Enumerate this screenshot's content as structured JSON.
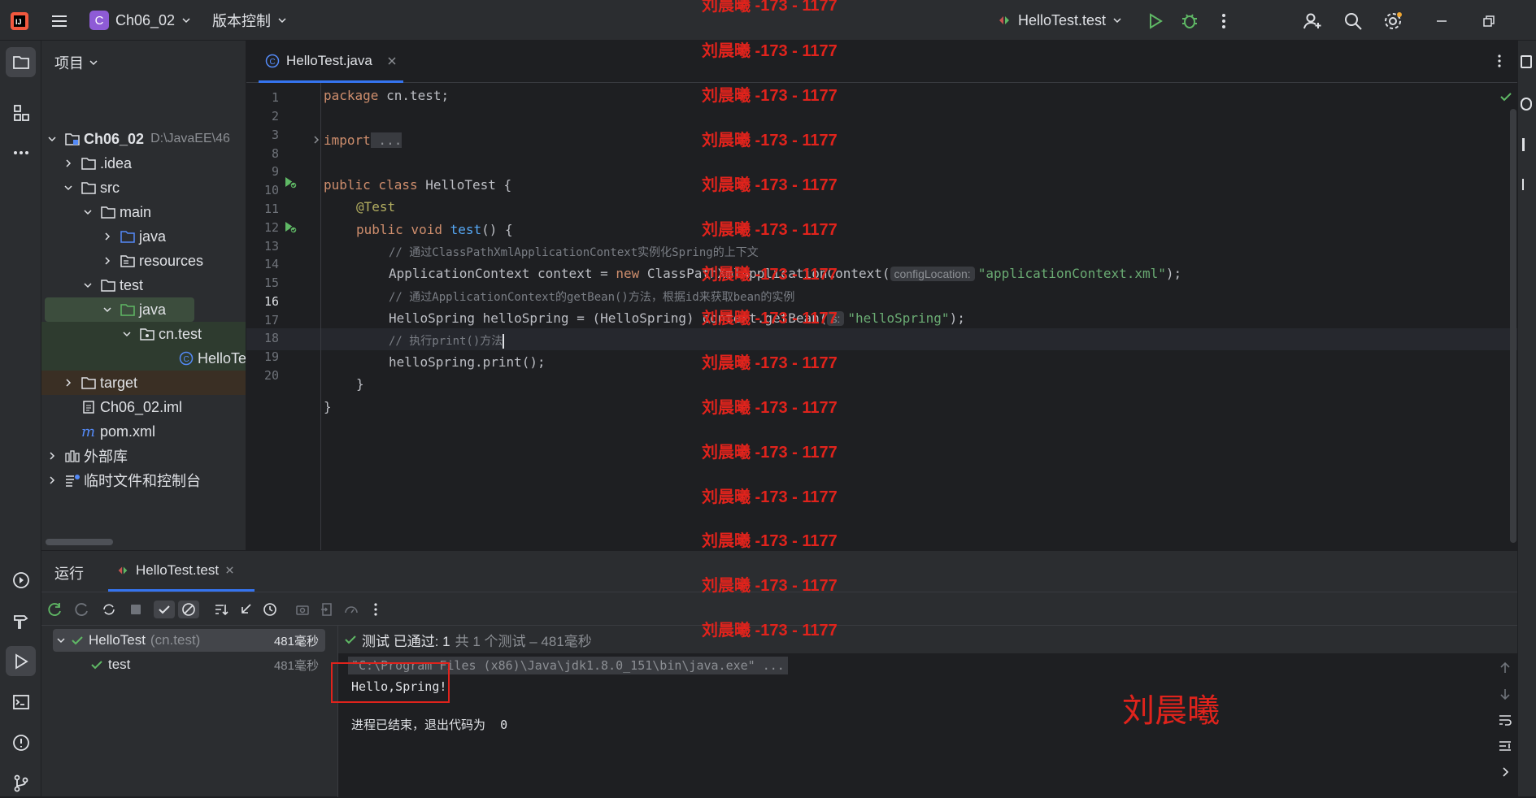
{
  "titlebar": {
    "project_initial": "C",
    "project_name": "Ch06_02",
    "vcs_menu": "版本控制",
    "run_config": "HelloTest.test"
  },
  "project_panel": {
    "title": "项目",
    "tree": [
      {
        "label": "Ch06_02",
        "hint": "D:\\JavaEE\\46",
        "bold": true
      },
      {
        "label": ".idea"
      },
      {
        "label": "src"
      },
      {
        "label": "main"
      },
      {
        "label": "java"
      },
      {
        "label": "resources"
      },
      {
        "label": "test"
      },
      {
        "label": "java"
      },
      {
        "label": "cn.test"
      },
      {
        "label": "HelloTest"
      },
      {
        "label": "target"
      },
      {
        "label": "Ch06_02.iml"
      },
      {
        "label": "pom.xml"
      },
      {
        "label": "外部库"
      },
      {
        "label": "临时文件和控制台"
      }
    ]
  },
  "editor": {
    "tab": "HelloTest.java",
    "line_numbers": [
      "1",
      "2",
      "3",
      "8",
      "9",
      "10",
      "11",
      "12",
      "13",
      "14",
      "15",
      "16",
      "17",
      "18",
      "19",
      "20"
    ],
    "lines": {
      "l1": [
        "package",
        " cn.test;"
      ],
      "l3": [
        "import",
        " ..."
      ],
      "l9": [
        "public class",
        " HelloTest {"
      ],
      "l10": "@Test",
      "l11": [
        "public void",
        " ",
        "test",
        "() {"
      ],
      "l12": "// 通过ClassPathXmlApplicationContext实例化Spring的上下文",
      "l13": [
        "ApplicationContext context = ",
        "new",
        " ClassPathXmlApplicationContext(",
        "configLocation:",
        "\"applicationContext.xml\"",
        ");"
      ],
      "l14": "// 通过ApplicationContext的getBean()方法，根据id来获取bean的实例",
      "l15": [
        "HelloSpring helloSpring = (HelloSpring) context.getBean(",
        "s:",
        "\"helloSpring\"",
        ");"
      ],
      "l16": "// 执行print()方法",
      "l17": "helloSpring.print();",
      "l18": "}",
      "l19": "}"
    }
  },
  "run_panel": {
    "tab_run": "运行",
    "tab_config": "HelloTest.test",
    "tree": [
      {
        "label": "HelloTest",
        "pkg": "(cn.test)",
        "time": "481毫秒"
      },
      {
        "label": "test",
        "time": "481毫秒"
      }
    ],
    "status_passed": "测试 已通过: 1",
    "status_rest": "共 1 个测试 – 481毫秒",
    "console": {
      "cmd": "\"C:\\Program Files (x86)\\Java\\jdk1.8.0_151\\bin\\java.exe\" ...",
      "out": "Hello,Spring!",
      "exit": "进程已结束，退出代码为  0"
    }
  },
  "watermark": {
    "text": "刘晨曦 -173 - 1177",
    "name": "刘晨曦"
  },
  "colors": {
    "accent": "#3574f0",
    "success": "#5fb865",
    "watermark": "#e0231c",
    "keyword": "#cf8e6d",
    "string": "#6aab73",
    "function": "#56a8f5"
  }
}
